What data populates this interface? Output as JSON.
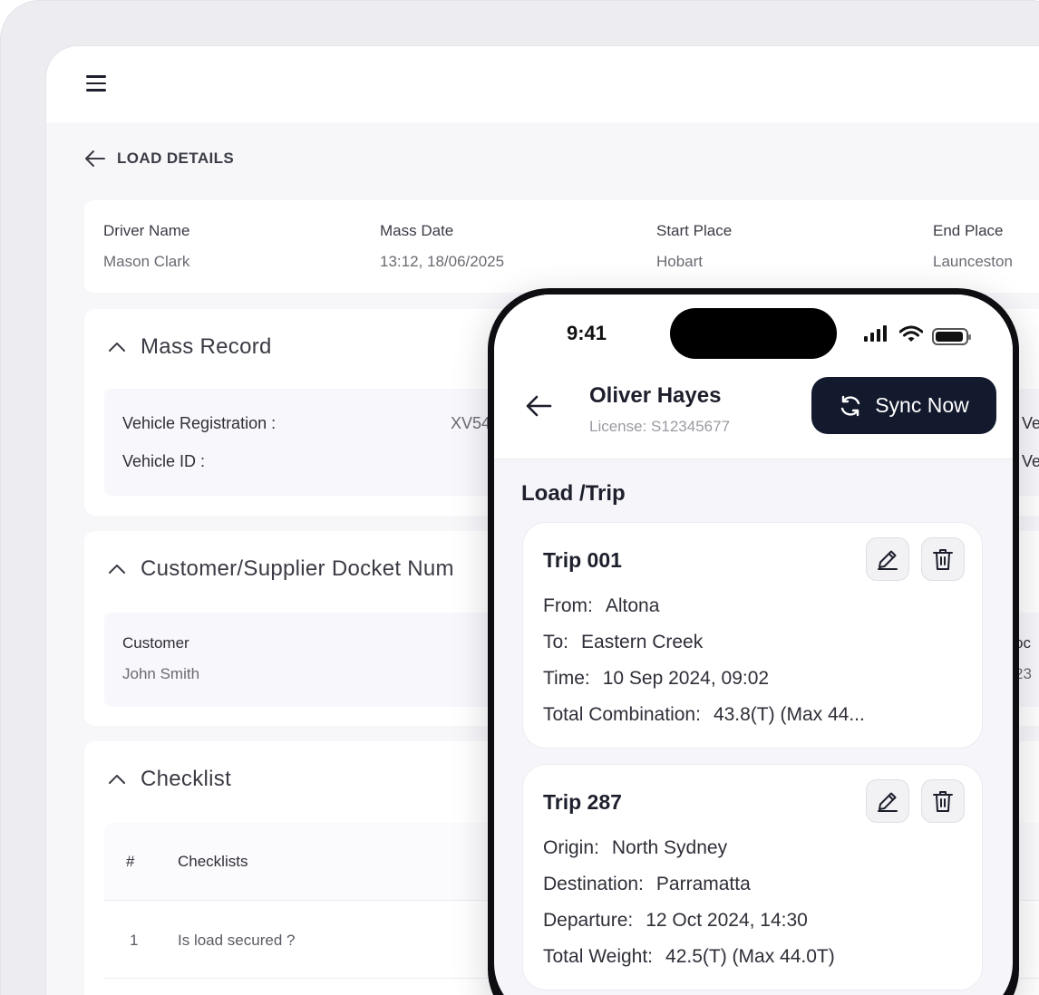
{
  "web": {
    "page_title": "LOAD DETAILS",
    "info": [
      {
        "label": "Driver Name",
        "value": "Mason Clark"
      },
      {
        "label": "Mass Date",
        "value": "13:12, 18/06/2025"
      },
      {
        "label": "Start Place",
        "value": "Hobart"
      },
      {
        "label": "End Place",
        "value": "Launceston"
      }
    ],
    "mass_record": {
      "title": "Mass Record",
      "vehicle_registration_label": "Vehicle Registration :",
      "vehicle_registration_value": "XV54",
      "vehicle_id_label": "Vehicle ID :",
      "right_peek_1": "Ve",
      "right_peek_2": "Ve"
    },
    "docket": {
      "title": "Customer/Supplier Docket Num",
      "customer_label": "Customer",
      "customer_value": "John Smith",
      "right_peek_label": "oc",
      "right_peek_value": "23"
    },
    "checklist": {
      "title": "Checklist",
      "col_num": "#",
      "col_checklists": "Checklists",
      "rows": [
        {
          "num": "1",
          "text": "Is load secured ?"
        }
      ]
    }
  },
  "phone": {
    "time": "9:41",
    "driver_name": "Oliver Hayes",
    "license": "License: S12345677",
    "sync_label": "Sync Now",
    "section_title": "Load /Trip",
    "trips": [
      {
        "title": "Trip 001",
        "lines": [
          {
            "k": "From:",
            "v": "Altona"
          },
          {
            "k": "To:",
            "v": "Eastern Creek"
          },
          {
            "k": "Time:",
            "v": "10 Sep 2024, 09:02"
          },
          {
            "k": "Total Combination:",
            "v": "43.8(T) (Max 44..."
          }
        ]
      },
      {
        "title": "Trip 287",
        "lines": [
          {
            "k": "Origin:",
            "v": "North Sydney"
          },
          {
            "k": "Destination:",
            "v": "Parramatta"
          },
          {
            "k": "Departure:",
            "v": "12 Oct 2024, 14:30"
          },
          {
            "k": "Total Weight:",
            "v": "42.5(T) (Max 44.0T)"
          }
        ]
      }
    ]
  }
}
